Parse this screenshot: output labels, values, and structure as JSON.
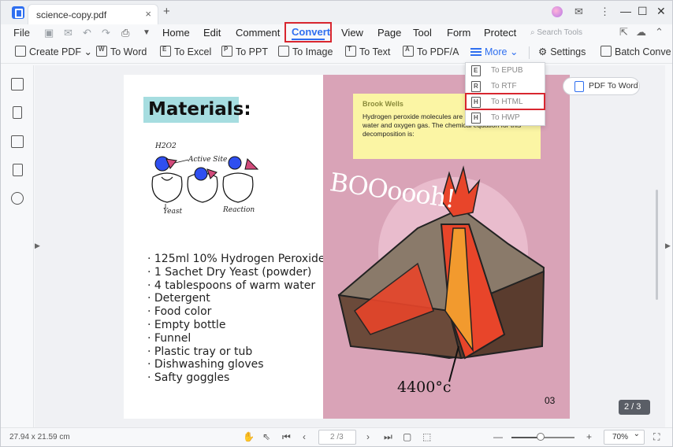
{
  "app": {
    "tab_title": "science-copy.pdf",
    "tab_close": "×",
    "tab_add": "+"
  },
  "window_controls": {
    "minimize": "—",
    "maximize": "☐",
    "close": "✕",
    "menu": "⋮",
    "feedback": "✉"
  },
  "menubar": {
    "file": "File",
    "items": [
      "Home",
      "Edit",
      "Comment",
      "Convert",
      "View",
      "Page",
      "Tool",
      "Form",
      "Protect"
    ],
    "active": "Convert",
    "search_placeholder": "Search Tools"
  },
  "toolbar": {
    "create_pdf": "Create PDF",
    "to_word": "To Word",
    "to_excel": "To Excel",
    "to_ppt": "To PPT",
    "to_image": "To Image",
    "to_text": "To Text",
    "to_pdfa": "To PDF/A",
    "more": "More",
    "settings": "Settings",
    "batch_convert": "Batch Conve"
  },
  "dropdown": {
    "items": [
      {
        "label": "To EPUB",
        "icon": "E"
      },
      {
        "label": "To RTF",
        "icon": "R"
      },
      {
        "label": "To HTML",
        "icon": "H"
      },
      {
        "label": "To HWP",
        "icon": "H"
      }
    ],
    "highlighted": "To HTML"
  },
  "pdf_to_word_button": "PDF To Word",
  "document": {
    "left_page": {
      "title": "Materials:",
      "doodle_labels": [
        "H2O2",
        "Active Site",
        "Yeast",
        "Reaction"
      ],
      "materials": [
        "· 125ml 10% Hydrogen Peroxide",
        "· 1 Sachet Dry Yeast (powder)",
        "· 4 tablespoons of warm water",
        "· Detergent",
        "· Food color",
        "· Empty bottle",
        "· Funnel",
        "· Plastic tray or tub",
        "· Dishwashing gloves",
        "· Safty goggles"
      ]
    },
    "right_page": {
      "note_author": "Brook Wells",
      "note_body": "Hydrogen peroxide molecules are naturally decompose into water and oxygen gas. The chemical equation for this decomposition is:",
      "boo_text": "BOOoooh!",
      "temperature": "4400°c",
      "page_number": "03"
    }
  },
  "page_indicator": "2 / 3",
  "statusbar": {
    "dimensions": "27.94 x 21.59 cm",
    "page_input": "2 /3",
    "zoom": "70%",
    "zoom_percent": 70
  },
  "colors": {
    "accent": "#2f6ff0",
    "highlight_red": "#d8262f",
    "title_bg": "#a6dde0",
    "note_bg": "#fbf5a4",
    "page_pink": "#d9a3b7"
  }
}
